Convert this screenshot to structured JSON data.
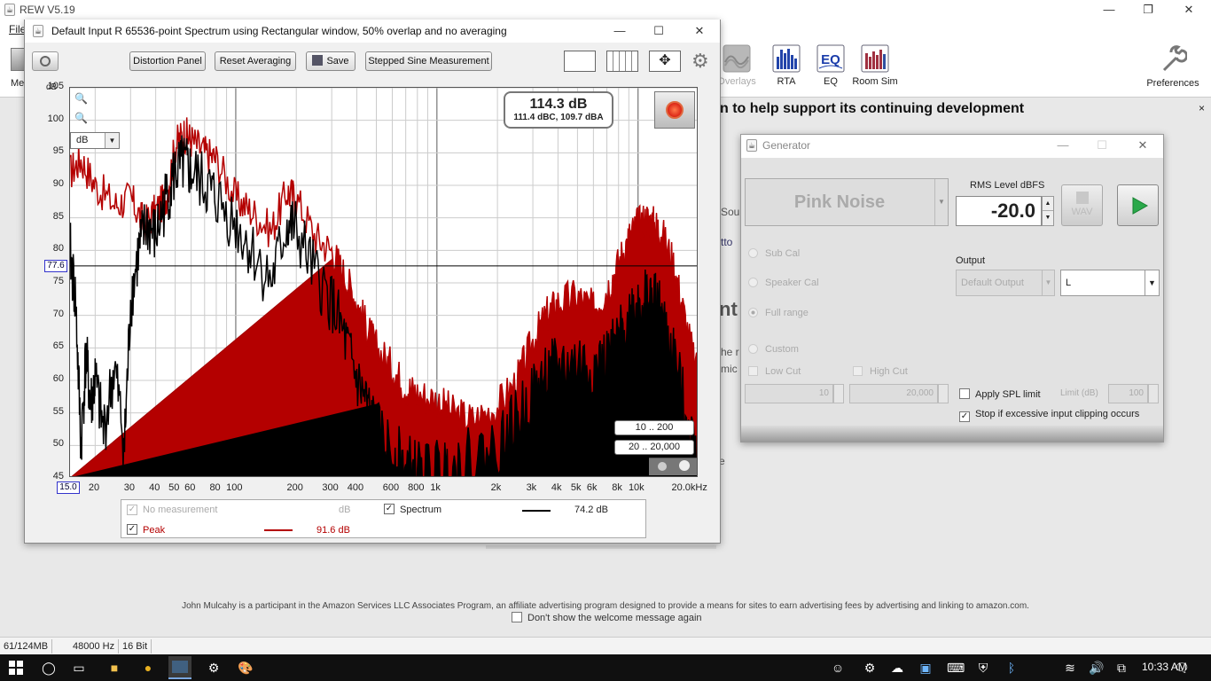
{
  "app": {
    "title": "REW V5.19",
    "menu_file": "File",
    "toolbar_partial_left": "Me",
    "toolbar": [
      {
        "label": "Overlays",
        "icon": "overlays-icon",
        "enabled": false
      },
      {
        "label": "RTA",
        "icon": "rta-icon",
        "enabled": true
      },
      {
        "label": "EQ",
        "icon": "eq-icon",
        "enabled": true
      },
      {
        "label": "Room Sim",
        "icon": "room-sim-icon",
        "enabled": true
      }
    ],
    "preferences_label": "Preferences",
    "support_banner": "n to help support its continuing development",
    "banner_close": "×",
    "welcome_fragments": [
      "Sou",
      "tto",
      "nt",
      "he r",
      "mic p",
      "e"
    ],
    "amazon_text": "John Mulcahy is a participant in the Amazon Services LLC Associates Program, an affiliate advertising program designed to provide a means for sites to earn advertising fees by advertising and linking to amazon.com.",
    "dont_show": "Don't show the welcome message again",
    "status": {
      "memory": "61/124MB",
      "rate": "48000 Hz",
      "bits": "16 Bit"
    }
  },
  "spectrum": {
    "title": "Default Input R 65536-point Spectrum using Rectangular window, 50% overlap and no averaging",
    "buttons": {
      "distortion": "Distortion Panel",
      "reset": "Reset Averaging",
      "save": "Save",
      "stepped": "Stepped Sine Measurement"
    },
    "spl_main": "114.3 dB",
    "spl_sub": "111.4 dBC, 109.7 dBA",
    "unit_select": "dB",
    "y_unit": "dB",
    "cursor_y": "77.6",
    "cursor_x": "15.0",
    "range_btn_1": "10 .. 200",
    "range_btn_2": "20 .. 20,000",
    "legend": {
      "no_measurement": "No measurement",
      "no_measurement_unit": "dB",
      "spectrum_label": "Spectrum",
      "spectrum_value": "74.2 dB",
      "peak_label": "Peak",
      "peak_value": "91.6 dB"
    }
  },
  "chart_data": {
    "type": "line",
    "title": "",
    "xlabel": "",
    "ylabel": "dB",
    "x_scale": "log",
    "xlim": [
      15,
      20000
    ],
    "ylim": [
      45,
      105
    ],
    "x_ticks": [
      "20",
      "30",
      "40",
      "50",
      "60",
      "80",
      "100",
      "200",
      "300",
      "400",
      "600",
      "800",
      "1k",
      "2k",
      "3k",
      "4k",
      "5k",
      "6k",
      "8k",
      "10k",
      "20.0kHz"
    ],
    "y_ticks": [
      "45",
      "50",
      "55",
      "60",
      "65",
      "70",
      "75",
      "80",
      "85",
      "90",
      "95",
      "100",
      "105"
    ],
    "grid": true,
    "cursor_level": 77.6,
    "series": [
      {
        "name": "Peak",
        "color": "#b40000",
        "x": [
          15,
          17,
          20,
          25,
          30,
          35,
          40,
          45,
          50,
          55,
          60,
          70,
          80,
          100,
          120,
          150,
          180,
          200,
          250,
          300,
          350,
          400,
          450,
          500,
          600,
          700,
          800,
          1000,
          1200,
          1500,
          2000,
          2500,
          3000,
          3500,
          4000,
          5000,
          6000,
          7000,
          8000,
          9000,
          10000,
          11000,
          12000,
          13000,
          15000,
          17000,
          20000
        ],
        "values": [
          92,
          94,
          90,
          87,
          88,
          84,
          86,
          88,
          96,
          98,
          97,
          95,
          94,
          88,
          86,
          83,
          89,
          88,
          82,
          80,
          76,
          72,
          68,
          65,
          62,
          59,
          58,
          57,
          55,
          54,
          56,
          60,
          66,
          70,
          72,
          73,
          71,
          74,
          78,
          82,
          84,
          85,
          84,
          83,
          78,
          70,
          60
        ]
      },
      {
        "name": "Spectrum",
        "color": "#000000",
        "x": [
          15,
          16,
          17,
          18,
          19,
          20,
          22,
          25,
          28,
          30,
          33,
          36,
          40,
          45,
          50,
          55,
          60,
          70,
          80,
          100,
          120,
          150,
          180,
          200,
          250,
          300,
          350,
          400,
          450,
          500,
          600,
          700,
          800,
          1000,
          1200,
          1500,
          2000,
          2500,
          3000,
          3500,
          4000,
          5000,
          6000,
          7000,
          8000,
          9000,
          10000,
          11000,
          12000,
          13000,
          15000,
          17000,
          20000
        ],
        "values": [
          80,
          72,
          50,
          64,
          56,
          60,
          52,
          62,
          50,
          72,
          80,
          84,
          82,
          88,
          92,
          93,
          92,
          90,
          88,
          84,
          80,
          75,
          84,
          83,
          76,
          72,
          66,
          60,
          56,
          52,
          49,
          47,
          46,
          46,
          47,
          48,
          50,
          54,
          58,
          61,
          62,
          63,
          62,
          63,
          66,
          70,
          72,
          73,
          72,
          70,
          64,
          56,
          48
        ]
      }
    ]
  }
}
